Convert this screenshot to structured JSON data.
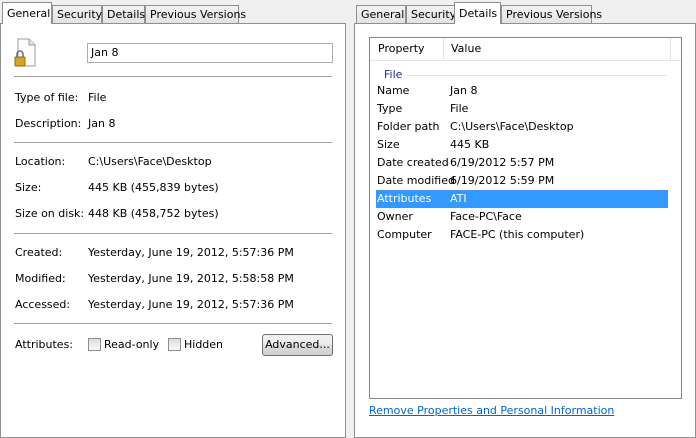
{
  "left": {
    "tabs": [
      "General",
      "Security",
      "Details",
      "Previous Versions"
    ],
    "active_tab": "General",
    "file_name": "Jan 8",
    "fields": [
      {
        "label": "Type of file:",
        "value": "File"
      },
      {
        "label": "Description:",
        "value": "Jan 8"
      },
      {
        "label": "Location:",
        "value": "C:\\Users\\Face\\Desktop"
      },
      {
        "label": "Size:",
        "value": "445 KB (455,839 bytes)"
      },
      {
        "label": "Size on disk:",
        "value": "448 KB (458,752 bytes)"
      },
      {
        "label": "Created:",
        "value": "Yesterday, June 19, 2012, 5:57:36 PM"
      },
      {
        "label": "Modified:",
        "value": "Yesterday, June 19, 2012, 5:58:58 PM"
      },
      {
        "label": "Accessed:",
        "value": "Yesterday, June 19, 2012, 5:57:36 PM"
      }
    ],
    "attributes_label": "Attributes:",
    "readonly_label": "Read-only",
    "hidden_label": "Hidden",
    "advanced_label": "Advanced..."
  },
  "right": {
    "tabs": [
      "General",
      "Security",
      "Details",
      "Previous Versions"
    ],
    "active_tab": "Details",
    "columns": [
      "Property",
      "Value"
    ],
    "group": "File",
    "rows": [
      {
        "property": "Name",
        "value": "Jan 8"
      },
      {
        "property": "Type",
        "value": "File"
      },
      {
        "property": "Folder path",
        "value": "C:\\Users\\Face\\Desktop"
      },
      {
        "property": "Size",
        "value": "445 KB"
      },
      {
        "property": "Date created",
        "value": "6/19/2012 5:57 PM"
      },
      {
        "property": "Date modified",
        "value": "6/19/2012 5:59 PM"
      },
      {
        "property": "Attributes",
        "value": "ATI",
        "selected": true
      },
      {
        "property": "Owner",
        "value": "Face-PC\\Face"
      },
      {
        "property": "Computer",
        "value": "FACE-PC (this computer)"
      }
    ],
    "remove_link": "Remove Properties and Personal Information"
  }
}
